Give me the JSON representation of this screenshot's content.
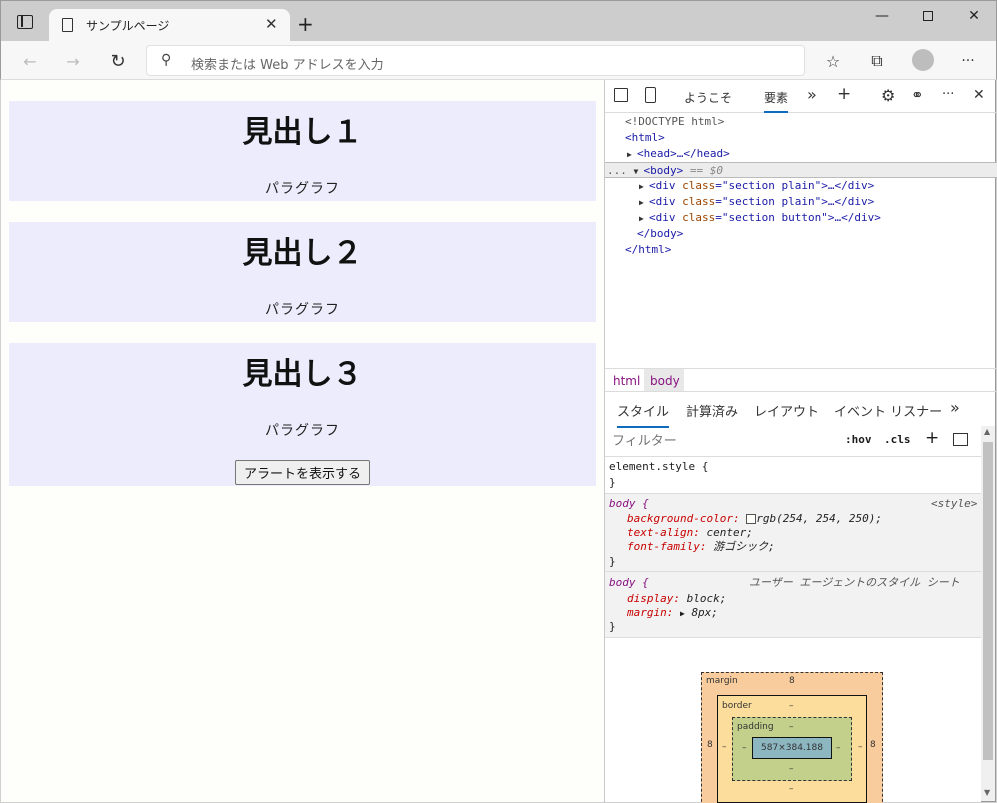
{
  "browser": {
    "tab_title": "サンプルページ",
    "address_placeholder": "検索または Web アドレスを入力"
  },
  "page": {
    "sections": [
      {
        "heading": "見出し１",
        "paragraph": "パラグラフ"
      },
      {
        "heading": "見出し２",
        "paragraph": "パラグラフ"
      },
      {
        "heading": "見出し３",
        "paragraph": "パラグラフ",
        "button": "アラートを表示する"
      }
    ]
  },
  "devtools": {
    "tabs": {
      "welcome": "ようこそ",
      "elements": "要素",
      "more": "»",
      "add": "+"
    },
    "dom": {
      "doctype": "<!DOCTYPE html>",
      "html_open": "<html>",
      "head": "<head>…</head>",
      "body_open": "<body>",
      "body_marker": "== $0",
      "ellipsis": "...",
      "div1_class": "section plain",
      "div2_class": "section plain",
      "div3_class": "section button",
      "div_open": "<div ",
      "div_attr": "class",
      "div_close": ">…</div>",
      "body_close": "</body>",
      "html_close": "</html>"
    },
    "breadcrumbs": [
      "html",
      "body"
    ],
    "sub_tabs": [
      "スタイル",
      "計算済み",
      "レイアウト",
      "イベント リスナー",
      "»"
    ],
    "filter_placeholder": "フィルター",
    "filter_tools": {
      "hov": ":hov",
      "cls": ".cls",
      "plus": "+"
    },
    "rules": {
      "element_style": "element.style {",
      "close": "}",
      "body_selector": "body {",
      "body_origin": "<style>",
      "bg_prop": "background-color:",
      "bg_val": "rgb(254, 254, 250);",
      "ta_prop": "text-align:",
      "ta_val": "center;",
      "ff_prop": "font-family:",
      "ff_val": "游ゴシック;",
      "ua_selector": "body {",
      "ua_origin": "ユーザー エージェントのスタイル シート",
      "display_prop": "display:",
      "display_val": "block;",
      "margin_prop": "margin:",
      "margin_val": "8px;"
    },
    "box_model": {
      "margin_label": "margin",
      "margin_value": "8",
      "margin_left": "8",
      "margin_right": "8",
      "border_label": "border",
      "border_dash": "–",
      "padding_label": "padding",
      "padding_dash": "–",
      "content": "587×384.188"
    }
  }
}
